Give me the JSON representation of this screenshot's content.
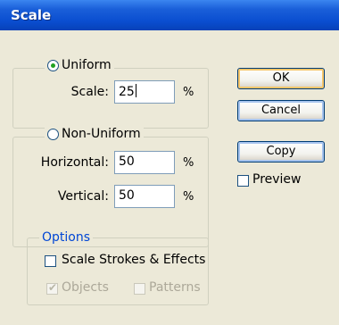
{
  "window": {
    "title": "Scale"
  },
  "uniform": {
    "label": "Uniform",
    "selected": true,
    "scale_label": "Scale:",
    "scale_value": "25",
    "unit": "%"
  },
  "non_uniform": {
    "label": "Non-Uniform",
    "selected": false,
    "horizontal_label": "Horizontal:",
    "horizontal_value": "50",
    "vertical_label": "Vertical:",
    "vertical_value": "50",
    "unit": "%"
  },
  "options": {
    "label": "Options",
    "scale_strokes_label": "Scale Strokes & Effects",
    "scale_strokes_checked": false,
    "objects_label": "Objects",
    "objects_checked": true,
    "objects_disabled": true,
    "patterns_label": "Patterns",
    "patterns_checked": false,
    "patterns_disabled": true
  },
  "buttons": {
    "ok": "OK",
    "cancel": "Cancel",
    "copy": "Copy"
  },
  "preview": {
    "label": "Preview",
    "checked": false
  },
  "colors": {
    "title_bar": "#0a4ed0",
    "dialog_bg": "#ece9d8",
    "group_label": "#0046d5",
    "disabled_text": "#aca899",
    "default_button_border": "#f6c66a"
  }
}
